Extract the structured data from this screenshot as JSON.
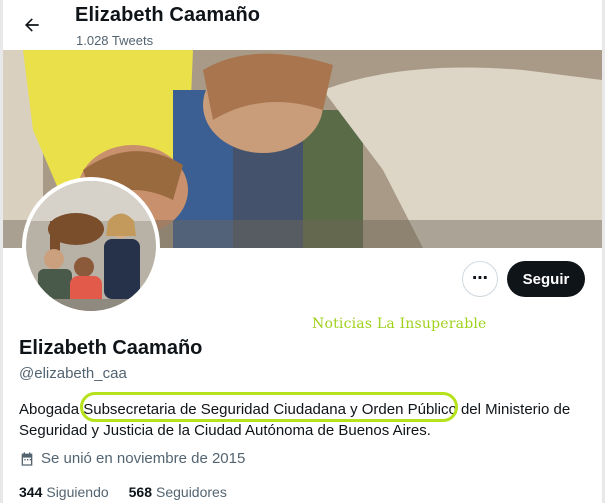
{
  "header": {
    "name": "Elizabeth Caamaño",
    "tweet_count": "1.028 Tweets"
  },
  "actions": {
    "more_label": "⋯",
    "follow_label": "Seguir"
  },
  "watermark": "Noticias La Insuperable",
  "profile": {
    "name": "Elizabeth Caamaño",
    "handle": "@elizabeth_caa",
    "bio_line1": "Abogada Subsecretaria de Seguridad Ciudadana y Orden Público del Ministerio de",
    "bio_line2": "Seguridad y Justicia de la Ciudad Autónoma de Buenos Aires.",
    "joined": "Se unió en noviembre de 2015"
  },
  "stats": {
    "following_count": "344",
    "following_label": "Siguiendo",
    "followers_count": "568",
    "followers_label": "Seguidores"
  },
  "colors": {
    "highlight": "#b5e21a",
    "watermark": "#9fd21d",
    "follow_button": "#0f1419"
  }
}
